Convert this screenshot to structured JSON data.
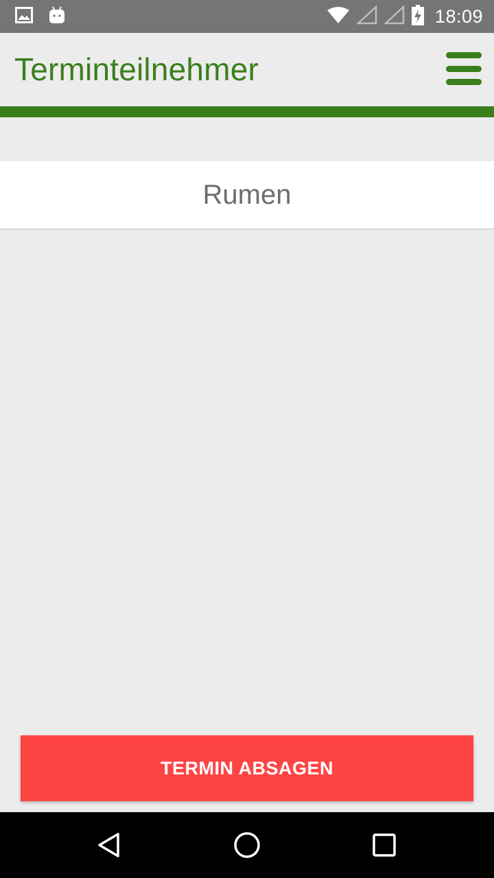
{
  "status_bar": {
    "time": "18:09",
    "icons": [
      "image-icon",
      "android-icon",
      "wifi-icon",
      "signal-icon",
      "signal-icon",
      "battery-charging-icon"
    ]
  },
  "toolbar": {
    "title": "Terminteilnehmer",
    "menu_icon": "hamburger-menu-icon"
  },
  "participants": [
    {
      "name": "Rumen"
    }
  ],
  "actions": {
    "cancel_label": "TERMIN ABSAGEN"
  },
  "nav_bar": {
    "icons": [
      "back-icon",
      "home-icon",
      "recents-icon"
    ]
  },
  "colors": {
    "accent": "#3b7f1d",
    "danger": "#ff4444",
    "status_bar": "#757575",
    "background": "#ececec"
  }
}
